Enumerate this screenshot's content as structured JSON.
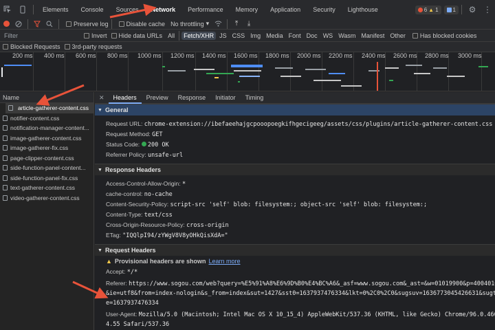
{
  "tabs": [
    "Elements",
    "Console",
    "Sources",
    "Network",
    "Performance",
    "Memory",
    "Application",
    "Security",
    "Lighthouse"
  ],
  "active_tab": "Network",
  "badges": {
    "errors": "6",
    "warnings": "1",
    "messages": "1"
  },
  "toolbar": {
    "preserve_log": "Preserve log",
    "disable_cache": "Disable cache",
    "throttling": "No throttling"
  },
  "filter": {
    "placeholder": "Filter",
    "invert": "Invert",
    "hide_data_urls": "Hide data URLs",
    "types": [
      "All",
      "Fetch/XHR",
      "JS",
      "CSS",
      "Img",
      "Media",
      "Font",
      "Doc",
      "WS",
      "Wasm",
      "Manifest",
      "Other"
    ],
    "active_type": "Fetch/XHR",
    "has_blocked_cookies": "Has blocked cookies",
    "blocked_requests": "Blocked Requests",
    "third_party": "3rd-party requests"
  },
  "timeline": {
    "ticks": [
      "200 ms",
      "400 ms",
      "600 ms",
      "800 ms",
      "1000 ms",
      "1200 ms",
      "1400 ms",
      "1600 ms",
      "1800 ms",
      "2000 ms",
      "2200 ms",
      "2400 ms",
      "2600 ms",
      "2800 ms",
      "3000 ms"
    ]
  },
  "requests": {
    "header": "Name",
    "items": [
      "article-gatherer-content.css",
      "notifier-content.css",
      "notification-manager-content...",
      "image-gatherer-content.css",
      "image-gatherer-fix.css",
      "page-clipper-content.css",
      "side-function-panel-content...",
      "side-function-panel-fix.css",
      "text-gatherer-content.css",
      "video-gatherer-content.css"
    ],
    "selected": 0
  },
  "detail": {
    "tabs": [
      "Headers",
      "Preview",
      "Response",
      "Initiator",
      "Timing"
    ],
    "active_tab": "Headers",
    "general": {
      "title": "General",
      "request_url_k": "Request URL:",
      "request_url_v": "chrome-extension://ibefaeehajgcpooopoegkifhgecigeeg/assets/css/plugins/article-gatherer-content.css",
      "method_k": "Request Method:",
      "method_v": "GET",
      "status_k": "Status Code:",
      "status_v": "200  OK",
      "referrer_k": "Referrer Policy:",
      "referrer_v": "unsafe-url"
    },
    "response_headers": {
      "title": "Response Headers",
      "acao_k": "Access-Control-Allow-Origin:",
      "acao_v": "*",
      "cc_k": "cache-control:",
      "cc_v": "no-cache",
      "csp_k": "Content-Security-Policy:",
      "csp_v": "script-src 'self' blob: filesystem:; object-src 'self' blob: filesystem:;",
      "ct_k": "Content-Type:",
      "ct_v": "text/css",
      "corp_k": "Cross-Origin-Resource-Policy:",
      "corp_v": "cross-origin",
      "etag_k": "ETag:",
      "etag_v": "\"IQQlpI94/zYWgV8V8yOHkQisXdA=\""
    },
    "request_headers": {
      "title": "Request Headers",
      "provisional": "Provisional headers are shown",
      "learn_more": "Learn more",
      "accept_k": "Accept:",
      "accept_v": "*/*",
      "referer_k": "Referer:",
      "referer_v1": "https://www.sogou.com/web?query=%E5%91%A8%E6%9D%B0%E4%BC%A6&_asf=www.sogou.com&_ast=&w=01019900&p=40040100",
      "referer_v2": "&ie=utf8&from=index-nologin&s_from=index&sut=1427&sst0=1637937476334&lkt=0%2C0%2C0&sugsuv=1636773045426631&sugtim",
      "referer_v3": "e=1637937476334",
      "ua_k": "User-Agent:",
      "ua_v1": "Mozilla/5.0 (Macintosh; Intel Mac OS X 10_15_4) AppleWebKit/537.36 (KHTML, like Gecko) Chrome/96.0.466",
      "ua_v2": "4.55 Safari/537.36"
    }
  },
  "colors": {
    "accent": "#7cacf8",
    "annotation_arrow": "#e8533a",
    "status_ok": "#34a853"
  }
}
